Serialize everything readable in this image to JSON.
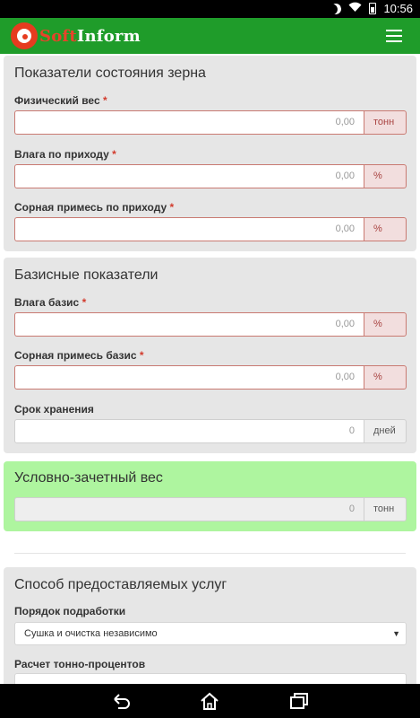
{
  "status_bar": {
    "time": "10:56",
    "icons": [
      "moon-icon",
      "wifi-icon",
      "battery-icon"
    ]
  },
  "app": {
    "logo_part1": "Soft",
    "logo_part2": "Inform",
    "menu_icon": "hamburger-menu-icon",
    "colors": {
      "app_bar": "#1f9c2a",
      "logo_accent": "#e63b1f",
      "required": "#d23b2d",
      "highlight_panel": "#aef59f"
    }
  },
  "grain": {
    "title": "Показатели состояния зерна",
    "fields": [
      {
        "label": "Физический вес",
        "value": "0,00",
        "unit": "тонн",
        "required": "*"
      },
      {
        "label": "Влага по приходу",
        "value": "0,00",
        "unit": "%",
        "required": "*"
      },
      {
        "label": "Сорная примесь по приходу",
        "value": "0,00",
        "unit": "%",
        "required": "*"
      }
    ]
  },
  "basis": {
    "title": "Базисные показатели",
    "fields": [
      {
        "label": "Влага базис",
        "value": "0,00",
        "unit": "%",
        "required": "*"
      },
      {
        "label": "Сорная примесь базис",
        "value": "0,00",
        "unit": "%",
        "required": "*"
      },
      {
        "label": "Срок хранения",
        "value": "0",
        "unit": "дней"
      }
    ]
  },
  "conditional": {
    "title": "Условно-зачетный вес",
    "value": "0",
    "unit": "тонн"
  },
  "services": {
    "title": "Способ предоставляемых услуг",
    "order_label": "Порядок подработки",
    "order_value": "Сушка и очистка независимо",
    "calc_label": "Расчет тонно-процентов"
  },
  "nav": {
    "icons": [
      "back-icon",
      "home-icon",
      "recent-apps-icon"
    ]
  }
}
